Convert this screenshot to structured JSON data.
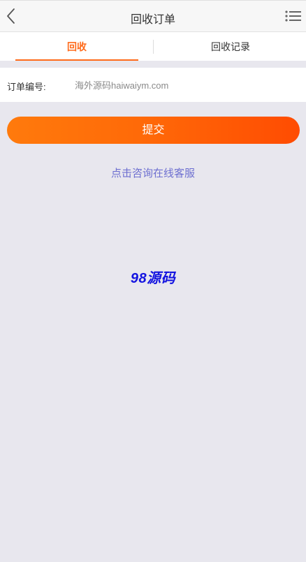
{
  "header": {
    "title": "回收订单",
    "back_icon": "chevron-left-icon",
    "menu_icon": "list-menu-icon"
  },
  "tabs": [
    {
      "label": "回收",
      "active": true
    },
    {
      "label": "回收记录",
      "active": false
    }
  ],
  "form": {
    "order_label": "订单编号:",
    "order_value": "海外源码haiwaiym.com"
  },
  "submit_label": "提交",
  "consult_link": "点击咨询在线客服",
  "watermark": "98源码",
  "colors": {
    "accent": "#ff6a1a",
    "button_start": "#ff7a0c",
    "button_end": "#ff4c02",
    "link": "#6d6fd0",
    "watermark": "#1414e0",
    "background": "#e8e7ee"
  }
}
